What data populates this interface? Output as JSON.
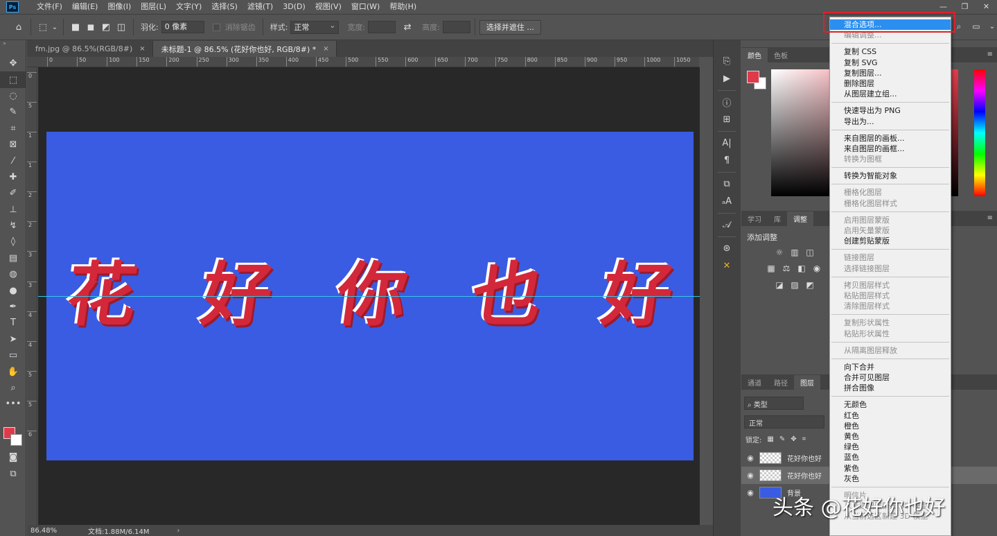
{
  "app": {
    "logo": "Ps"
  },
  "menu": [
    "文件(F)",
    "编辑(E)",
    "图像(I)",
    "图层(L)",
    "文字(Y)",
    "选择(S)",
    "滤镜(T)",
    "3D(D)",
    "视图(V)",
    "窗口(W)",
    "帮助(H)"
  ],
  "options": {
    "feather_label": "羽化:",
    "feather_value": "0 像素",
    "antialias_label": "消除锯齿",
    "style_label": "样式:",
    "style_value": "正常",
    "width_label": "宽度:",
    "height_label": "高度:",
    "select_mask_button": "选择并遮住 ..."
  },
  "tabs": [
    {
      "label": "fm.jpg @ 86.5%(RGB/8#)",
      "close": "×"
    },
    {
      "label": "未标题-1 @ 86.5% (花好你也好, RGB/8#) *",
      "close": "×"
    }
  ],
  "ruler": {
    "top": [
      "0",
      "50",
      "100",
      "150",
      "200",
      "250",
      "300",
      "350",
      "400",
      "450",
      "500",
      "550",
      "600",
      "650",
      "700",
      "750",
      "800",
      "850",
      "900",
      "950",
      "1000",
      "1050"
    ],
    "left": [
      "0",
      "5",
      "1",
      "1",
      "2",
      "2",
      "3",
      "3",
      "4",
      "4",
      "5",
      "5",
      "6"
    ]
  },
  "canvas": {
    "chars": [
      "花",
      "好",
      "你",
      "也",
      "好"
    ],
    "background_color": "#3a5ce2",
    "text_color": "#d3283a"
  },
  "status": {
    "zoom": "86.48%",
    "doc_info": "文档:1.88M/6.14M",
    "arrow": "›"
  },
  "panels": {
    "color_tabs": [
      "颜色",
      "色板"
    ],
    "adjust_tabs": [
      "学习",
      "库",
      "调整"
    ],
    "adjust_title": "添加调整",
    "layer_tabs": [
      "通道",
      "路径",
      "图层"
    ],
    "layer_filter": "类型",
    "blend_mode": "正常",
    "lock_label": "锁定:",
    "layers": [
      {
        "name": "花好你也好",
        "visible_icon": "eye-icon",
        "thumb": "transparent"
      },
      {
        "name": "花好你也好",
        "visible_icon": "eye-icon",
        "thumb": "transparent"
      },
      {
        "name": "背景",
        "visible_icon": "eye-icon",
        "thumb": "blue"
      }
    ]
  },
  "context_menu": {
    "groups": [
      [
        {
          "label": "混合选项...",
          "state": "highlighted"
        },
        {
          "label": "编辑调整...",
          "state": "disabled"
        }
      ],
      [
        {
          "label": "复制 CSS",
          "state": "enabled"
        },
        {
          "label": "复制 SVG",
          "state": "enabled"
        },
        {
          "label": "复制图层...",
          "state": "enabled"
        },
        {
          "label": "删除图层",
          "state": "enabled"
        },
        {
          "label": "从图层建立组...",
          "state": "enabled"
        }
      ],
      [
        {
          "label": "快速导出为 PNG",
          "state": "enabled"
        },
        {
          "label": "导出为...",
          "state": "enabled"
        }
      ],
      [
        {
          "label": "来自图层的画板...",
          "state": "enabled"
        },
        {
          "label": "来自图层的画框...",
          "state": "enabled"
        },
        {
          "label": "转换为图框",
          "state": "disabled"
        }
      ],
      [
        {
          "label": "转换为智能对象",
          "state": "enabled"
        }
      ],
      [
        {
          "label": "栅格化图层",
          "state": "disabled"
        },
        {
          "label": "栅格化图层样式",
          "state": "disabled"
        }
      ],
      [
        {
          "label": "启用图层蒙版",
          "state": "disabled"
        },
        {
          "label": "启用矢量蒙版",
          "state": "disabled"
        },
        {
          "label": "创建剪贴蒙版",
          "state": "enabled"
        }
      ],
      [
        {
          "label": "链接图层",
          "state": "disabled"
        },
        {
          "label": "选择链接图层",
          "state": "disabled"
        }
      ],
      [
        {
          "label": "拷贝图层样式",
          "state": "disabled"
        },
        {
          "label": "粘贴图层样式",
          "state": "disabled"
        },
        {
          "label": "清除图层样式",
          "state": "disabled"
        }
      ],
      [
        {
          "label": "复制形状属性",
          "state": "disabled"
        },
        {
          "label": "粘贴形状属性",
          "state": "disabled"
        }
      ],
      [
        {
          "label": "从隔离图层释放",
          "state": "disabled"
        }
      ],
      [
        {
          "label": "向下合并",
          "state": "enabled"
        },
        {
          "label": "合并可见图层",
          "state": "enabled"
        },
        {
          "label": "拼合图像",
          "state": "enabled"
        }
      ],
      [
        {
          "label": "无颜色",
          "state": "enabled"
        },
        {
          "label": "红色",
          "state": "enabled"
        },
        {
          "label": "橙色",
          "state": "enabled"
        },
        {
          "label": "黄色",
          "state": "enabled"
        },
        {
          "label": "绿色",
          "state": "enabled"
        },
        {
          "label": "蓝色",
          "state": "enabled"
        },
        {
          "label": "紫色",
          "state": "enabled"
        },
        {
          "label": "灰色",
          "state": "enabled"
        }
      ],
      [
        {
          "label": "明信片",
          "state": "disabled"
        },
        {
          "label": "从所选图层新建 3D 模型",
          "state": "disabled"
        },
        {
          "label": "从当前选区新建 3D 模型",
          "state": "disabled"
        }
      ]
    ]
  },
  "watermark": "头条 @花好你也好"
}
